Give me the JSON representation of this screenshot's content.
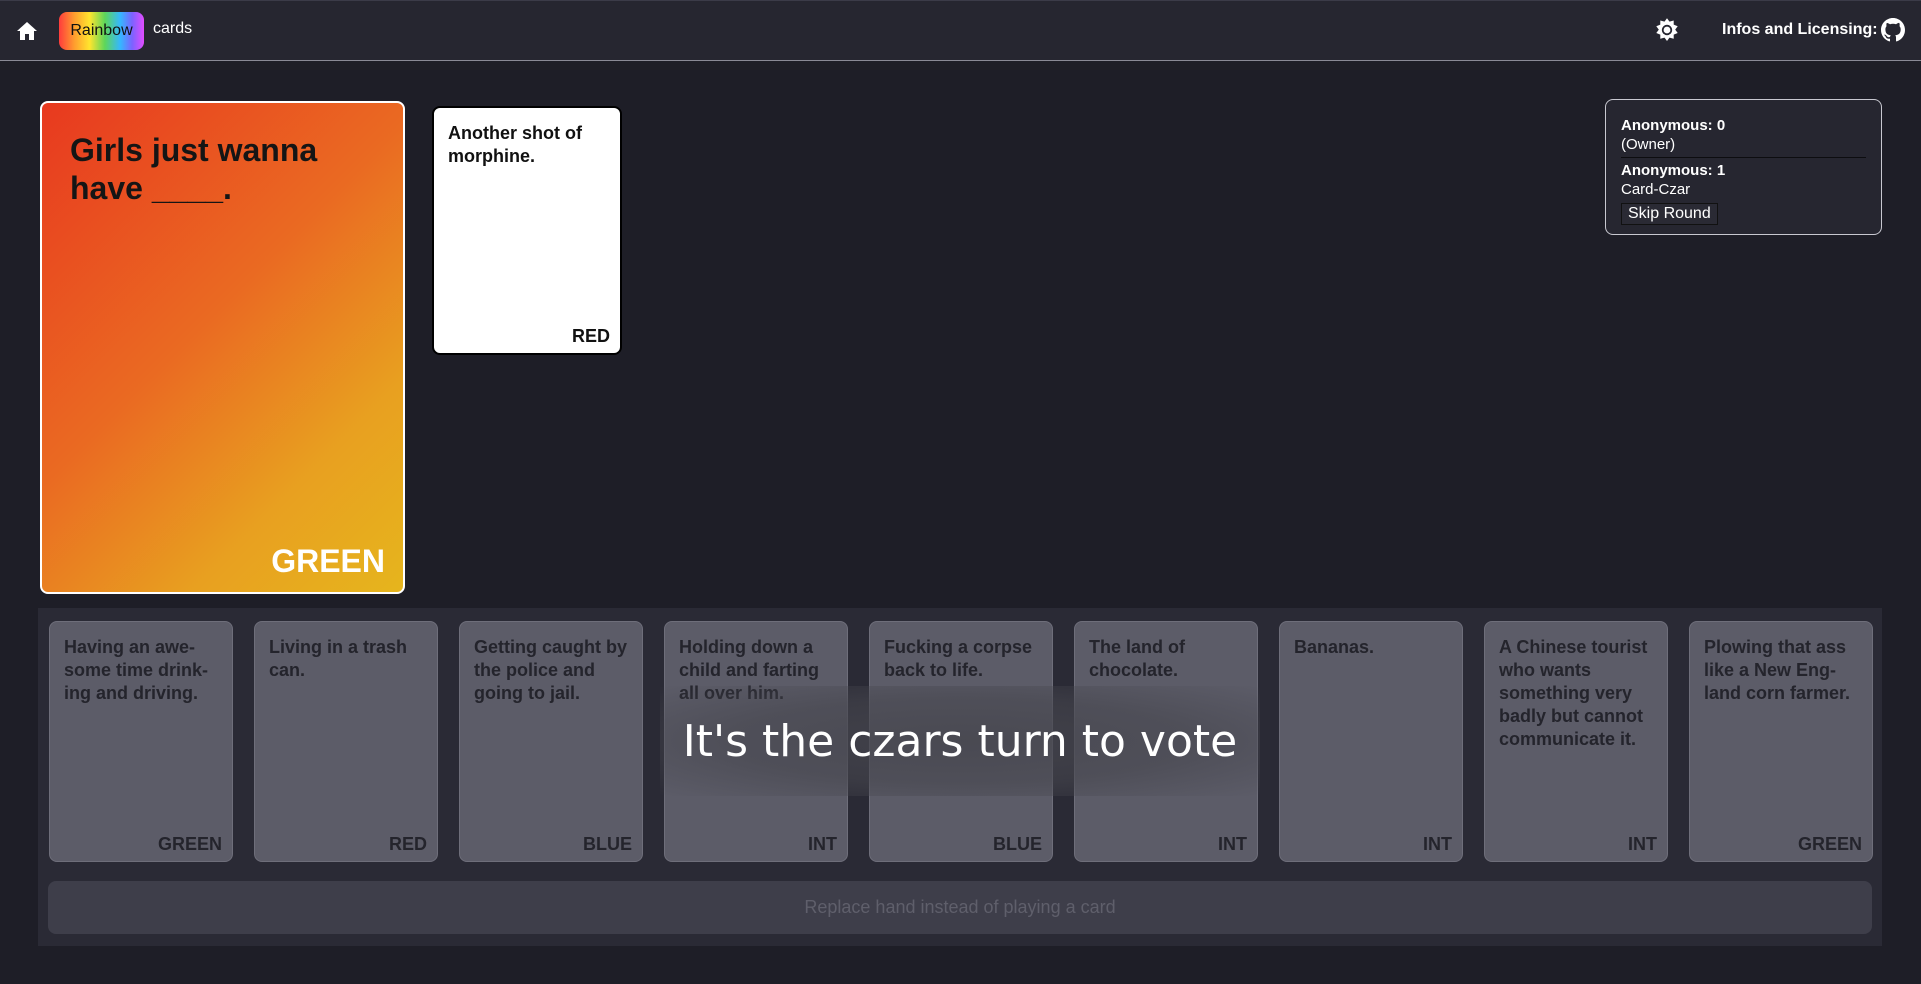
{
  "header": {
    "brand_badge": "Rainbow",
    "brand_text": "cards",
    "info_link": "Infos and Licensing:"
  },
  "black_card": {
    "text": "Girls just wanna have ____.",
    "tag": "GREEN"
  },
  "played_card": {
    "text": "Another shot of morphine.",
    "tag": "RED"
  },
  "players": [
    {
      "name": "Anonymous: 0",
      "role": "(Owner)"
    },
    {
      "name": "Anonymous: 1",
      "role": "Card-Czar"
    }
  ],
  "skip_round_label": "Skip Round",
  "hand": [
    {
      "text": "Having an awe-some time drink-ing and driving.",
      "tag": "GREEN"
    },
    {
      "text": "Living in a trash can.",
      "tag": "RED"
    },
    {
      "text": "Getting caught by the police and going to jail.",
      "tag": "BLUE"
    },
    {
      "text": "Holding down a child and farting all over him.",
      "tag": "INT"
    },
    {
      "text": "Fucking a corpse back to life.",
      "tag": "BLUE"
    },
    {
      "text": "The land of chocolate.",
      "tag": "INT"
    },
    {
      "text": "Bananas.",
      "tag": "INT"
    },
    {
      "text": "A Chinese tourist who wants something very badly but cannot communicate it.",
      "tag": "INT"
    },
    {
      "text": "Plowing that ass like a New Eng-land corn farmer.",
      "tag": "GREEN"
    }
  ],
  "vote_overlay": "It's the czars turn to vote",
  "replace_hand_label": "Replace hand instead of playing a card",
  "icons": {
    "home": "home-icon",
    "theme": "brightness-icon",
    "github": "github-icon"
  }
}
